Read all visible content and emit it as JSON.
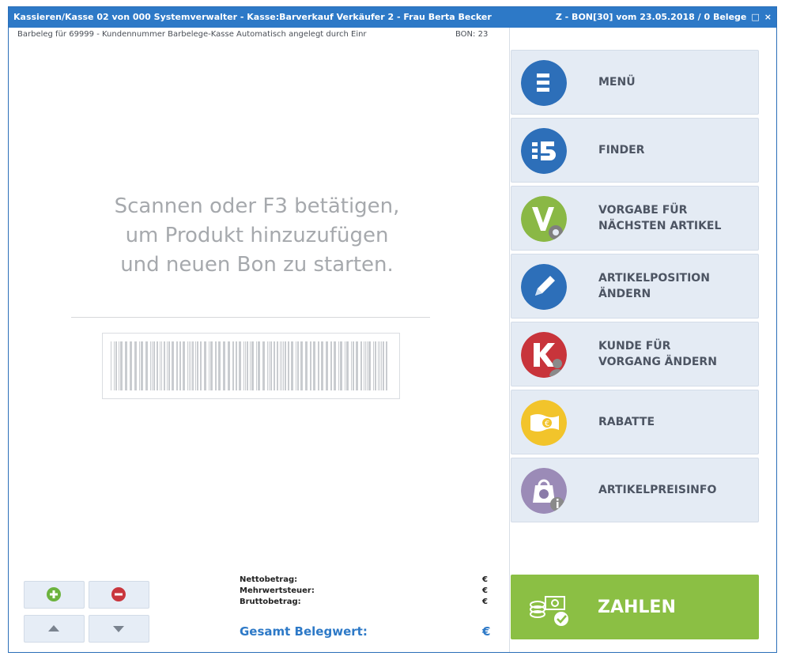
{
  "window": {
    "title": "Kassieren/Kasse 02 von 000 Systemverwalter - Kasse:Barverkauf Verkäufer 2 - Frau Berta Becker",
    "status": "Z - BON[30] vom 23.05.2018 / 0 Belege",
    "controls": [
      "□",
      "×"
    ]
  },
  "receipt": {
    "info": "Barbeleg für 69999 - Kundennummer Barbelege-Kasse Automatisch angelegt durch Einr",
    "bon": "BON: 23",
    "scan_message": [
      "Scannen oder F3 betätigen,",
      "um Produkt hinzuzufügen",
      "und neuen Bon zu starten."
    ]
  },
  "totals": {
    "netto_label": "Nettobetrag:",
    "mwst_label": "Mehrwertsteuer:",
    "brutto_label": "Bruttobetrag:",
    "currency": "€",
    "gesamt_label": "Gesamt Belegwert:"
  },
  "menu": [
    {
      "line1": "MENÜ",
      "line2": "",
      "icon": "menu-icon",
      "color": "#2d6fb9"
    },
    {
      "line1": "FINDER",
      "line2": "",
      "icon": "finder-icon",
      "color": "#2d6fb9"
    },
    {
      "line1": "VORGABE FÜR",
      "line2": "NÄCHSTEN ARTIKEL",
      "icon": "preset-icon",
      "color": "#8ab845"
    },
    {
      "line1": "ARTIKELPOSITION",
      "line2": "ÄNDERN",
      "icon": "pencil-icon",
      "color": "#2d6fb9"
    },
    {
      "line1": "KUNDE FÜR",
      "line2": "VORGANG ÄNDERN",
      "icon": "customer-icon",
      "color": "#c8343b"
    },
    {
      "line1": "RABATTE",
      "line2": "",
      "icon": "discount-icon",
      "color": "#f2c42b"
    },
    {
      "line1": "ARTIKELPREISINFO",
      "line2": "",
      "icon": "price-info-icon",
      "color": "#9b8bb7"
    }
  ],
  "pay": {
    "label": "ZAHLEN",
    "icon": "pay-icon",
    "color": "#8bbf44"
  }
}
